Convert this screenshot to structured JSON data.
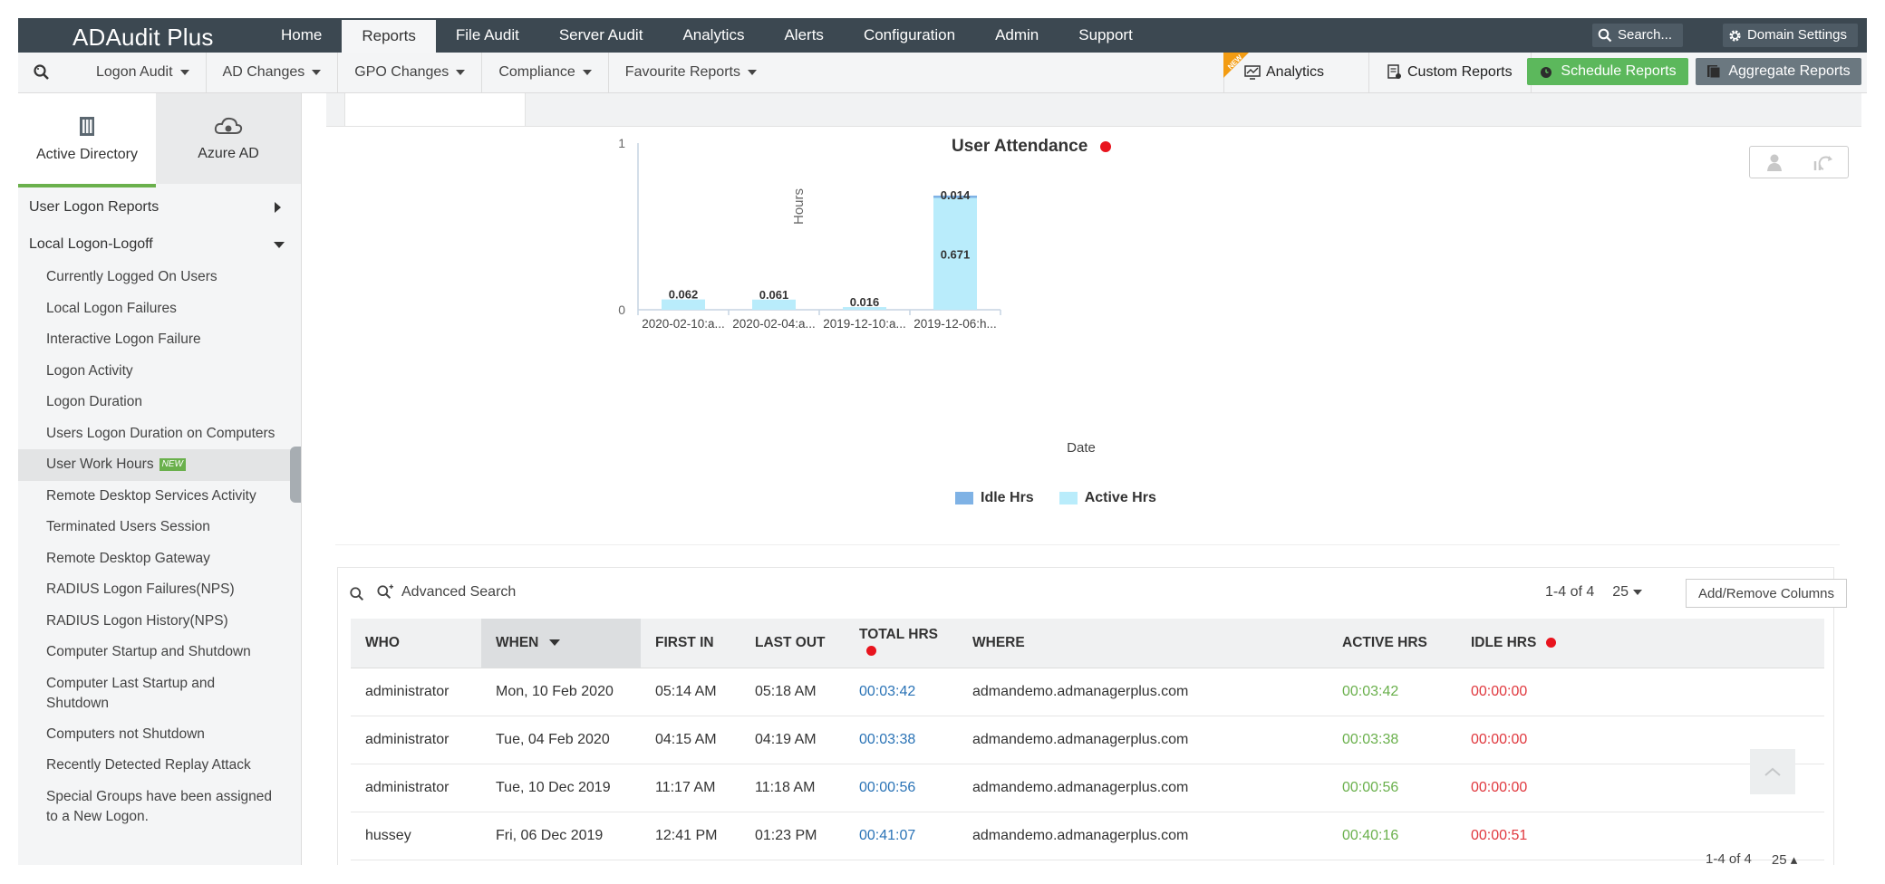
{
  "app": {
    "title": "ADAudit Plus"
  },
  "topnav": {
    "tabs": [
      "Home",
      "Reports",
      "File Audit",
      "Server Audit",
      "Analytics",
      "Alerts",
      "Configuration",
      "Admin",
      "Support"
    ],
    "active_tab": "Reports",
    "search_label": "Search...",
    "domain_settings_label": "Domain Settings"
  },
  "subnav": {
    "menus": [
      "Logon Audit",
      "AD Changes",
      "GPO Changes",
      "Compliance",
      "Favourite Reports"
    ],
    "analytics_label": "Analytics",
    "new_flag": "NEW",
    "custom_reports_label": "Custom Reports",
    "schedule_reports_label": "Schedule Reports",
    "aggregate_reports_label": "Aggregate Reports"
  },
  "sidebar": {
    "tabs": [
      {
        "label": "Active Directory",
        "icon": "building-icon"
      },
      {
        "label": "Azure AD",
        "icon": "cloud-icon"
      }
    ],
    "sections": [
      {
        "label": "User Logon Reports",
        "expanded": false
      },
      {
        "label": "Local Logon-Logoff",
        "expanded": true
      }
    ],
    "items": [
      "Currently Logged On Users",
      "Local Logon Failures",
      "Interactive Logon Failure",
      "Logon Activity",
      "Logon Duration",
      "Users Logon Duration on Computers",
      "User Work Hours",
      "Remote Desktop Services Activity",
      "Terminated Users Session",
      "Remote Desktop Gateway",
      "RADIUS Logon Failures(NPS)",
      "RADIUS Logon History(NPS)",
      "Computer Startup and Shutdown",
      "Computer Last Startup and Shutdown",
      "Computers not Shutdown",
      "Recently Detected Replay Attack",
      "Special Groups have been assigned to a New Logon."
    ],
    "active_item": "User Work Hours",
    "new_badge": "NEW"
  },
  "chart_data": {
    "type": "bar",
    "title": "User Attendance",
    "xlabel": "Date",
    "ylabel": "Hours",
    "ylim": [
      0,
      1
    ],
    "yticks": [
      "0",
      "1"
    ],
    "categories": [
      "2020-02-10:a...",
      "2020-02-04:a...",
      "2019-12-10:a...",
      "2019-12-06:h..."
    ],
    "stacked": true,
    "series": [
      {
        "name": "Active Hrs",
        "color": "#b9ecfb",
        "values": [
          0.062,
          0.061,
          0.016,
          0.671
        ],
        "labels": [
          "0.062",
          "0.061",
          "0.016",
          "0.671"
        ]
      },
      {
        "name": "Idle Hrs",
        "color": "#7fb2e5",
        "values": [
          0,
          0,
          0,
          0.014
        ],
        "labels": [
          "",
          "",
          "",
          "0.014"
        ]
      }
    ],
    "grid": false,
    "legend": "bottom"
  },
  "table": {
    "advanced_search_label": "Advanced Search",
    "range": "1-4 of 4",
    "page_size": "25",
    "add_remove_label": "Add/Remove Columns",
    "columns": [
      "WHO",
      "WHEN",
      "FIRST IN",
      "LAST OUT",
      "TOTAL HRS",
      "WHERE",
      "ACTIVE HRS",
      "IDLE HRS"
    ],
    "rows": [
      [
        "administrator",
        "Mon, 10 Feb 2020",
        "05:14 AM",
        "05:18 AM",
        "00:03:42",
        "admandemo.admanagerplus.com",
        "00:03:42",
        "00:00:00"
      ],
      [
        "administrator",
        "Tue, 04 Feb 2020",
        "04:15 AM",
        "04:19 AM",
        "00:03:38",
        "admandemo.admanagerplus.com",
        "00:03:38",
        "00:00:00"
      ],
      [
        "administrator",
        "Tue, 10 Dec 2019",
        "11:17 AM",
        "11:18 AM",
        "00:00:56",
        "admandemo.admanagerplus.com",
        "00:00:56",
        "00:00:00"
      ],
      [
        "hussey",
        "Fri, 06 Dec 2019",
        "12:41 PM",
        "01:23 PM",
        "00:41:07",
        "admandemo.admanagerplus.com",
        "00:40:16",
        "00:00:51"
      ]
    ],
    "bottom_range": "1-4 of 4",
    "bottom_page_size": "25"
  },
  "colors": {
    "topbar": "#3c4851",
    "accent_green": "#5cb85c",
    "status_red": "#e8141e",
    "link_blue": "#2a73b6"
  }
}
